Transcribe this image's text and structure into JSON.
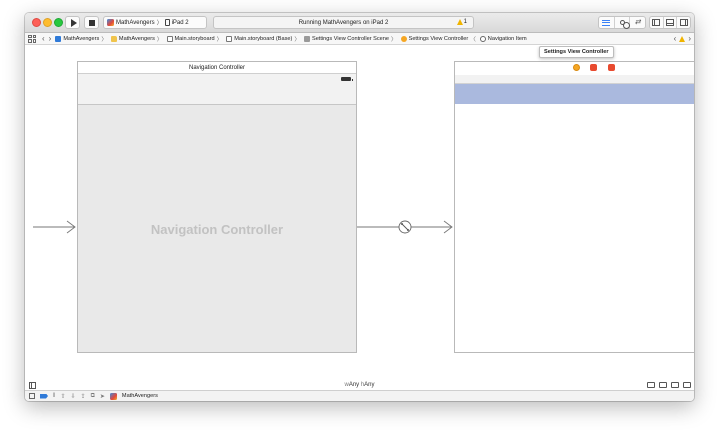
{
  "toolbar": {
    "scheme": {
      "app": "MathAvengers",
      "device": "iPad 2"
    },
    "activity": {
      "status": "Running MathAvengers on iPad 2",
      "warning_count": "1"
    }
  },
  "jumpbar": {
    "crumbs": [
      {
        "label": "MathAvengers",
        "icon": "project-icon"
      },
      {
        "label": "MathAvengers",
        "icon": "folder-icon"
      },
      {
        "label": "Main.storyboard",
        "icon": "storyboard-icon"
      },
      {
        "label": "Main.storyboard (Base)",
        "icon": "storyboard-icon"
      },
      {
        "label": "Settings View Controller Scene",
        "icon": "scene-icon"
      },
      {
        "label": "Settings View Controller",
        "icon": "view-controller-icon"
      },
      {
        "label": "Navigation Item",
        "icon": "navigation-item-icon"
      }
    ]
  },
  "canvas": {
    "nav_controller": {
      "scene_title": "Navigation Controller",
      "placeholder": "Navigation Controller"
    },
    "settings_vc": {
      "tooltip": "Settings View Controller"
    },
    "colors": {
      "selection": "#aab9de",
      "placeholder_text": "#c2c2c2"
    }
  },
  "size_class": {
    "width_prefix": "w",
    "width": "Any",
    "height_prefix": "h",
    "height": "Any"
  },
  "debugbar": {
    "target": "MathAvengers"
  }
}
